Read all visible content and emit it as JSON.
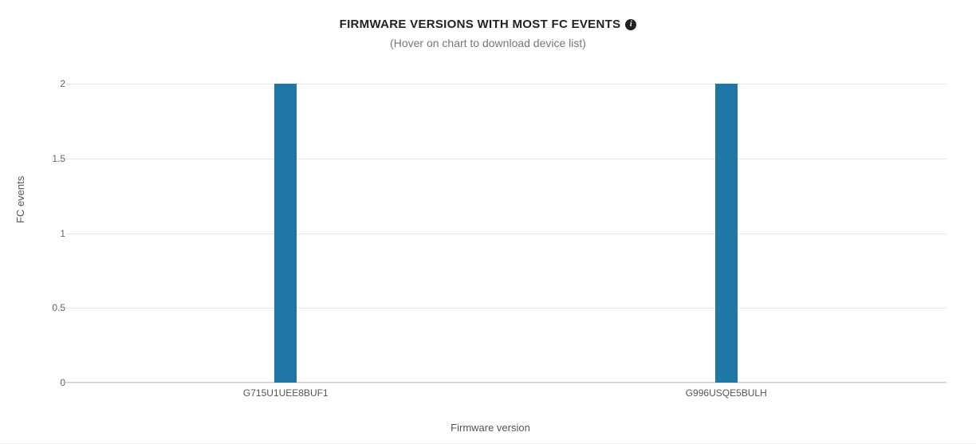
{
  "title": "FIRMWARE VERSIONS WITH MOST FC EVENTS",
  "subtitle": "(Hover on chart to download device list)",
  "info_icon_glyph": "i",
  "chart_data": {
    "type": "bar",
    "title": "FIRMWARE VERSIONS WITH MOST FC EVENTS",
    "xlabel": "Firmware version",
    "ylabel": "FC events",
    "categories": [
      "G715U1UEE8BUF1",
      "G996USQE5BULH"
    ],
    "values": [
      2,
      2
    ],
    "ylim": [
      0,
      2
    ],
    "y_ticks": [
      0,
      0.5,
      1,
      1.5,
      2
    ],
    "bar_color": "#1f77a8"
  }
}
